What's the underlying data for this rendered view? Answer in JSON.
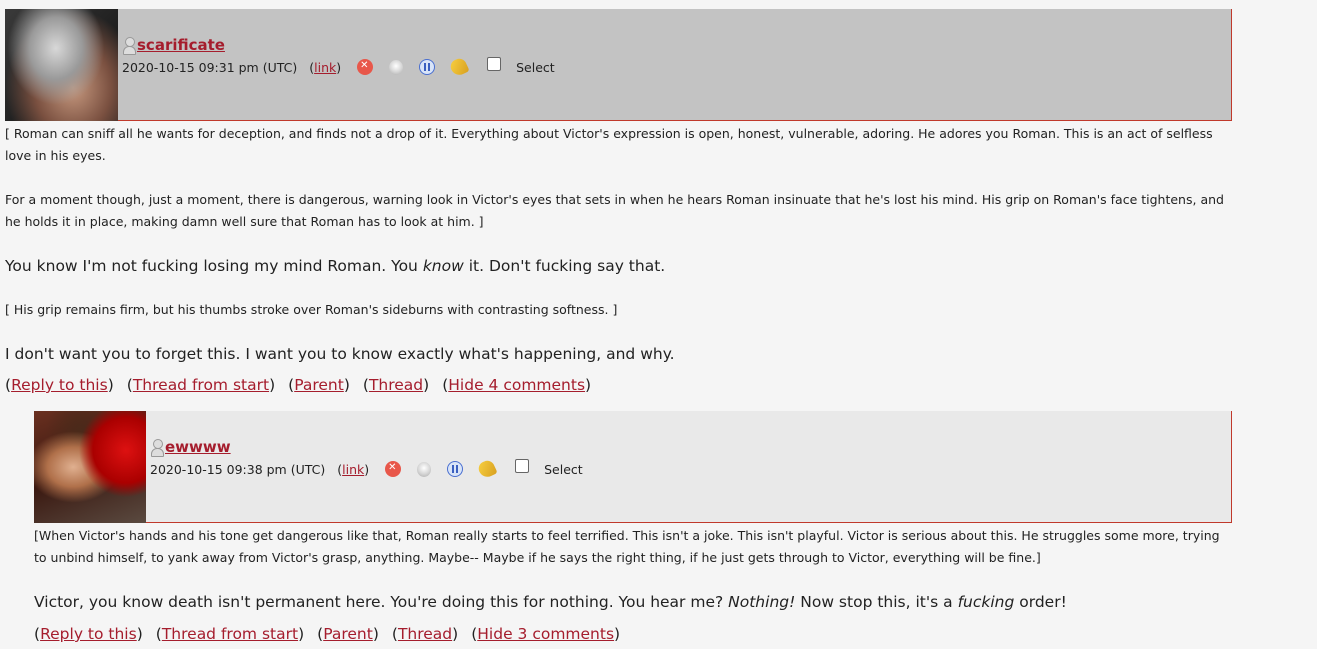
{
  "comments": [
    {
      "username": "scarificate",
      "date": "2020-10-15 09:31 pm (UTC)",
      "link_label": "link",
      "select_label": "Select",
      "paragraphs": [
        "[ Roman can sniff all he wants for deception, and finds not a drop of it. Everything about Victor's expression is open, honest, vulnerable, adoring. He adores you Roman. This is an act of selfless love in his eyes.",
        "For a moment though, just a moment, there is dangerous, warning look in Victor's eyes that sets in when he hears Roman insinuate that he's lost his mind. His grip on Roman's face tightens, and he holds it in place, making damn well sure that Roman has to look at him. ]",
        "You know I'm not fucking losing my mind Roman. You ",
        "know",
        " it. Don't fucking say that.",
        "[ His grip remains firm, but his thumbs stroke over Roman's sideburns with contrasting softness. ]",
        "I don't want you to forget this. I want you to know exactly what's happening, and why."
      ],
      "actions": [
        "Reply to this",
        "Thread from start",
        "Parent",
        "Thread",
        "Hide 4 comments"
      ]
    },
    {
      "username": "ewwww",
      "date": "2020-10-15 09:38 pm (UTC)",
      "link_label": "link",
      "select_label": "Select",
      "paragraphs": [
        "[When Victor's hands and his tone get dangerous like that, Roman really starts to feel terrified. This isn't a joke. This isn't playful. Victor is serious about this. He struggles some more, trying to unbind himself, to yank away from Victor's grasp, anything. Maybe-- Maybe if he says the right thing, if he just gets through to Victor, everything will be fine.]",
        "Victor, you know death isn't permanent here. You're doing this for nothing. You hear me? ",
        "Nothing!",
        " Now stop this, it's a ",
        "fucking",
        " order!"
      ],
      "actions": [
        "Reply to this",
        "Thread from start",
        "Parent",
        "Thread",
        "Hide 3 comments"
      ]
    }
  ]
}
